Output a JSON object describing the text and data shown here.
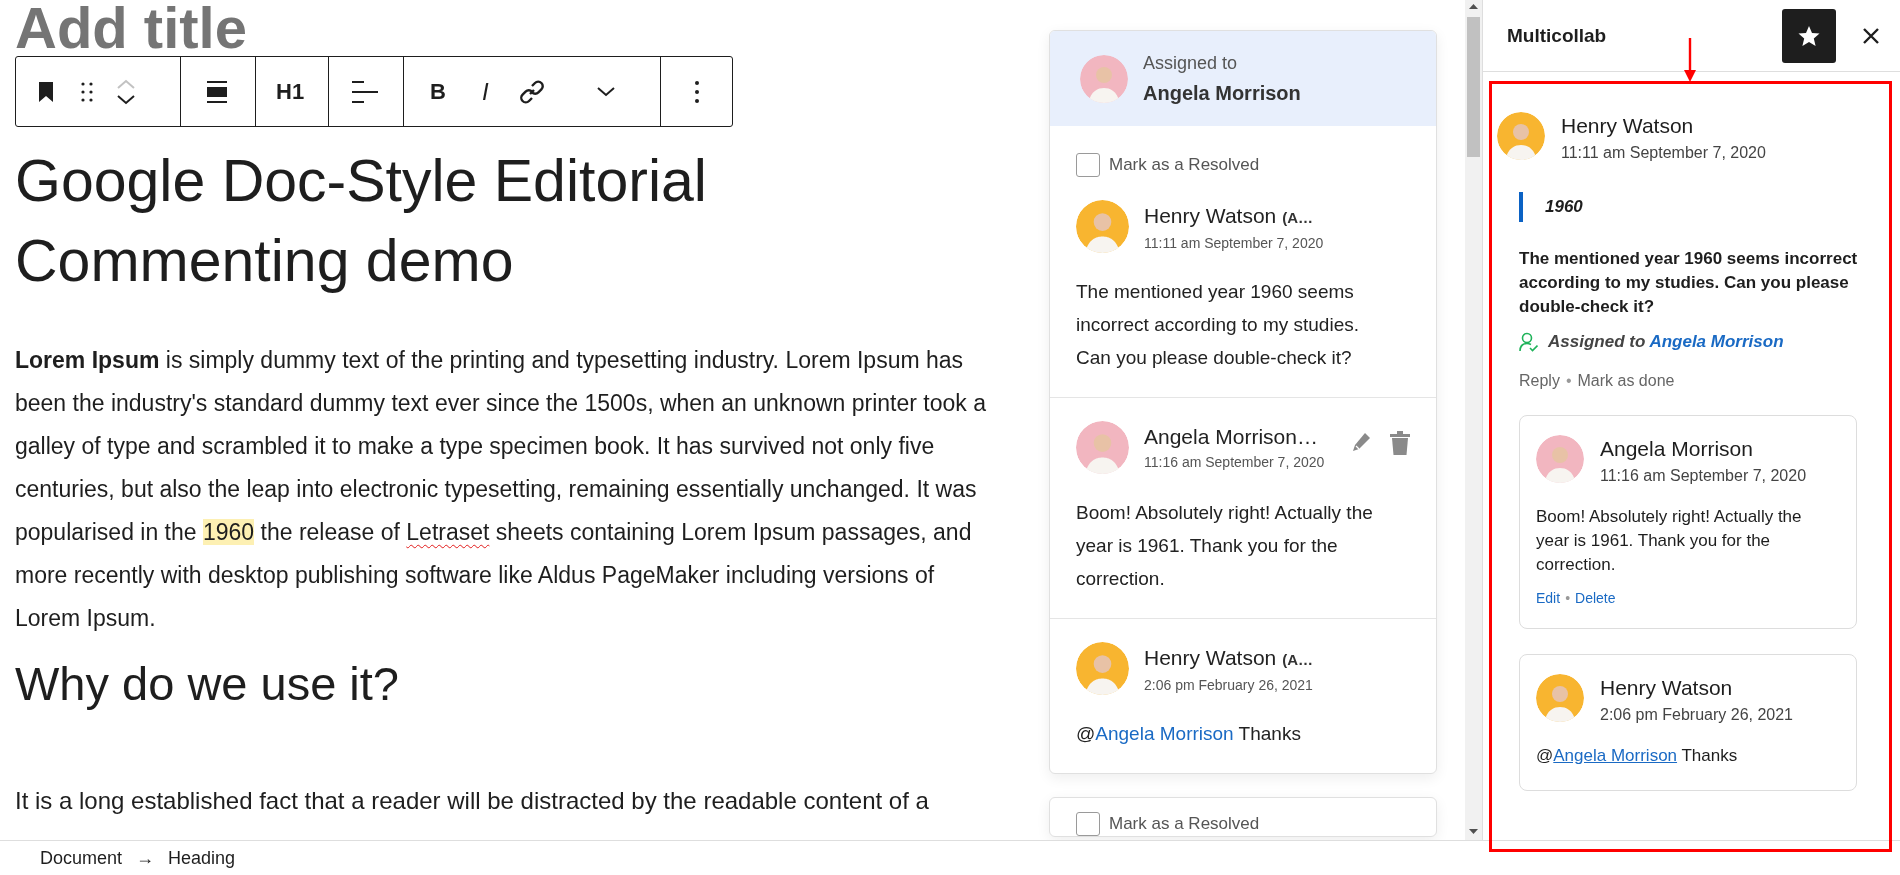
{
  "editor": {
    "title_placeholder": "Add title",
    "toolbar": {
      "move_up": {
        "disabled": true
      },
      "move_down": {
        "disabled": false
      },
      "heading_level": "H1",
      "bold": "B",
      "italic": "I"
    },
    "heading": "Google Doc-Style Editorial Commenting demo",
    "paragraph": [
      {
        "kind": "bold",
        "text": "Lorem Ipsum"
      },
      {
        "kind": "text",
        "text": " is simply dummy text of the printing and typesetting industry. Lorem Ipsum has been the industry's standard dummy text ever since the 1500s, when an unknown printer took a galley of type and scrambled it to make a type specimen book. It has survived not only five centuries, but also the leap into electronic typesetting, remaining essentially unchanged. It was popularised in the "
      },
      {
        "kind": "highlight",
        "text": "1960"
      },
      {
        "kind": "text",
        "text": " the release of "
      },
      {
        "kind": "misspelled",
        "text": "Letraset"
      },
      {
        "kind": "text",
        "text": " sheets containing Lorem Ipsum passages, and more recently with desktop publishing software like Aldus PageMaker including versions of Lorem Ipsum."
      }
    ],
    "subheading": "Why do we use it?",
    "paragraph_2": "It is a long established fact that a reader will be distracted by the readable content of a"
  },
  "threads": [
    {
      "assigned_label": "Assigned to",
      "assignee": "Angela Morrison",
      "color": "#f2b6c0",
      "resolve_label": "Mark as a Resolved",
      "resolved": false,
      "comments": [
        {
          "author": "Henry Watson",
          "role": "(A…",
          "time": "11:11 am September 7, 2020",
          "color": "#f8b530",
          "editable": false,
          "parts": [
            {
              "kind": "text",
              "text": "The mentioned year 1960 seems incorrect according to my studies. Can you please double-check it?"
            }
          ]
        },
        {
          "author": "Angela Morrison…",
          "time": "11:16 am September 7, 2020",
          "color": "#f2b6c0",
          "editable": true,
          "parts": [
            {
              "kind": "text",
              "text": "Boom! Absolutely right! Actually the year is 1961. Thank you for the correction."
            }
          ]
        },
        {
          "author": "Henry Watson",
          "role": "(A…",
          "time": "2:06 pm February 26, 2021",
          "color": "#f8b530",
          "editable": false,
          "parts": [
            {
              "kind": "text",
              "text": "@"
            },
            {
              "kind": "mention",
              "text": "Angela Morrison"
            },
            {
              "kind": "text",
              "text": " Thanks"
            }
          ]
        }
      ]
    },
    {
      "resolve_label": "Mark as a Resolved",
      "resolved": false
    }
  ],
  "sidebar": {
    "title": "Multicollab",
    "thread": {
      "author": "Henry Watson",
      "time": "11:11 am September 7, 2020",
      "color": "#f8b530",
      "quote": "1960",
      "text": "The mentioned year 1960 seems incorrect according to my studies. Can you please double-check it?",
      "assigned_label": "Assigned to",
      "assignee": "Angela Morrison",
      "actions": [
        "Reply",
        "Mark as done"
      ],
      "separator": "•",
      "replies": [
        {
          "author": "Angela Morrison",
          "time": "11:16 am September 7, 2020",
          "color": "#f2b6c0",
          "parts": [
            {
              "kind": "text",
              "text": "Boom! Absolutely right! Actually the year is 1961. Thank you for the correction."
            }
          ],
          "actions": [
            "Edit",
            "Delete"
          ]
        },
        {
          "author": "Henry Watson",
          "time": "2:06 pm February 26, 2021",
          "color": "#f8b530",
          "parts": [
            {
              "kind": "text",
              "text": "@"
            },
            {
              "kind": "mention",
              "text": "Angela Morrison"
            },
            {
              "kind": "text",
              "text": " Thanks"
            }
          ]
        }
      ]
    }
  },
  "breadcrumb": {
    "items": [
      "Document",
      "Heading"
    ],
    "separator": "→"
  }
}
